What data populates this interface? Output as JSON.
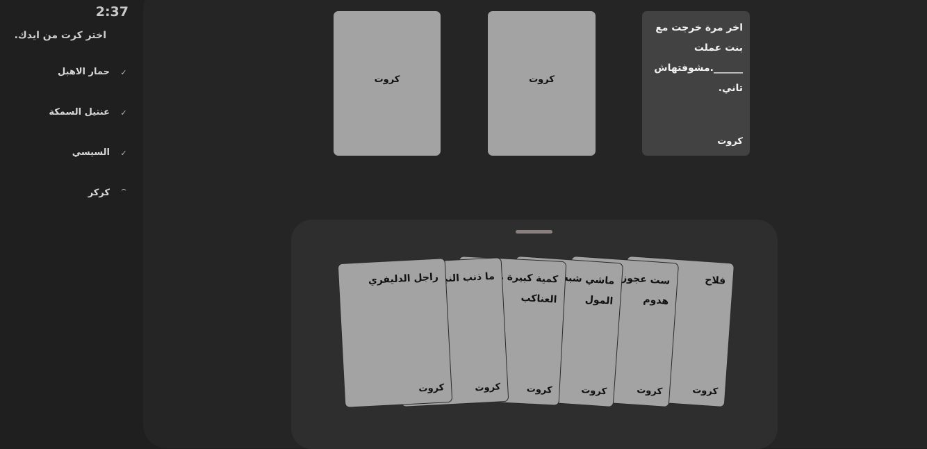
{
  "sidebar": {
    "timer": "2:37",
    "instruction": "اختر كرت من ايدك.",
    "players": [
      {
        "name": "حمار الاهبل",
        "status": "✓"
      },
      {
        "name": "عنتيل السمكة",
        "status": "✓"
      },
      {
        "name": "السيسي",
        "status": "✓"
      },
      {
        "name": "كركر",
        "status": ""
      }
    ]
  },
  "table": {
    "black_card": {
      "text": "اخر مرة خرجت مع بنت عملت ______.مشوفتهاش تاني.",
      "brand": "كروت"
    },
    "played_cards": [
      {
        "label": "كروت"
      },
      {
        "label": "كروت"
      }
    ]
  },
  "hand": {
    "cards": [
      {
        "text": "فلاح",
        "brand": "كروت"
      },
      {
        "text": "ست عجوزة هدوم",
        "brand": "كروت"
      },
      {
        "text": "ماشي شبه المول",
        "brand": "كروت"
      },
      {
        "text": "كمية كبيرة من العناكب",
        "brand": "كروت"
      },
      {
        "text": "ما ذنب النبات",
        "brand": "كروت"
      },
      {
        "text": "راجل الدليفري",
        "brand": "كروت"
      }
    ]
  }
}
